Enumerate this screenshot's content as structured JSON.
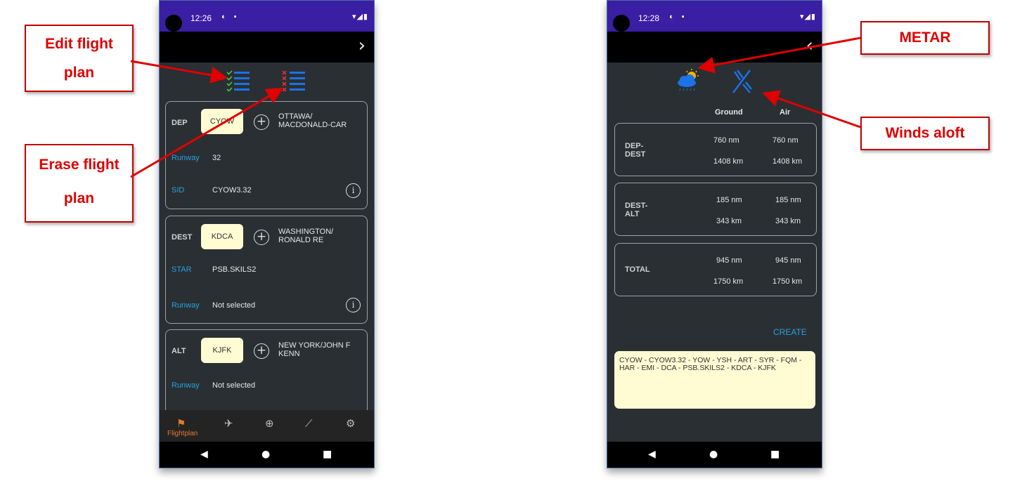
{
  "callouts": {
    "edit": {
      "line1": "Edit flight",
      "line2": "plan"
    },
    "erase": {
      "line1": "Erase flight",
      "line2": "plan"
    },
    "metar": "METAR",
    "winds": "Winds aloft"
  },
  "left_phone": {
    "status_time": "12:26",
    "dep": {
      "label": "DEP",
      "code": "CYOW",
      "name_line1": "OTTAWA/",
      "name_line2": "MACDONALD-CAR",
      "runway_label": "Runway",
      "runway_value": "32",
      "sid_label": "SID",
      "sid_value": "CYOW3.32"
    },
    "dest": {
      "label": "DEST",
      "code": "KDCA",
      "name_line1": "WASHINGTON/",
      "name_line2": "RONALD RE",
      "star_label": "STAR",
      "star_value": "PSB.SKILS2",
      "runway_label": "Runway",
      "runway_value": "Not selected"
    },
    "alt": {
      "label": "ALT",
      "code": "KJFK",
      "name_line1": "NEW YORK/JOHN F",
      "name_line2": "KENN",
      "runway_label": "Runway",
      "runway_value": "Not selected"
    },
    "nav_active_label": "Flightplan"
  },
  "right_phone": {
    "status_time": "12:28",
    "col_ground": "Ground",
    "col_air": "Air",
    "rows": [
      {
        "label_line1": "DEP-",
        "label_line2": "DEST",
        "ground_nm": "760 nm",
        "air_nm": "760 nm",
        "ground_km": "1408 km",
        "air_km": "1408 km"
      },
      {
        "label_line1": "DEST-",
        "label_line2": "ALT",
        "ground_nm": "185 nm",
        "air_nm": "185 nm",
        "ground_km": "343 km",
        "air_km": "343 km"
      },
      {
        "label_line1": "TOTAL",
        "label_line2": "",
        "ground_nm": "945 nm",
        "air_nm": "945 nm",
        "ground_km": "1750 km",
        "air_km": "1750 km"
      }
    ],
    "create_label": "CREATE",
    "route": "CYOW - CYOW3.32 - YOW - YSH - ART - SYR - FQM - HAR - EMI - DCA - PSB.SKILS2 - KDCA - KJFK"
  },
  "colors": {
    "accent_red": "#e00000",
    "status_purple": "#3a1ea3",
    "label_blue": "#29a0e0",
    "code_bg": "#fffbd3",
    "nav_orange": "#e07a2c"
  },
  "icons": [
    "edit-flight-plan-icon",
    "erase-flight-plan-icon",
    "plus-icon",
    "info-icon",
    "flightplan-tab-icon",
    "aircraft-tab-icon",
    "globe-tab-icon",
    "chart-tab-icon",
    "settings-tab-icon",
    "metar-weather-icon",
    "winds-aloft-icon"
  ]
}
